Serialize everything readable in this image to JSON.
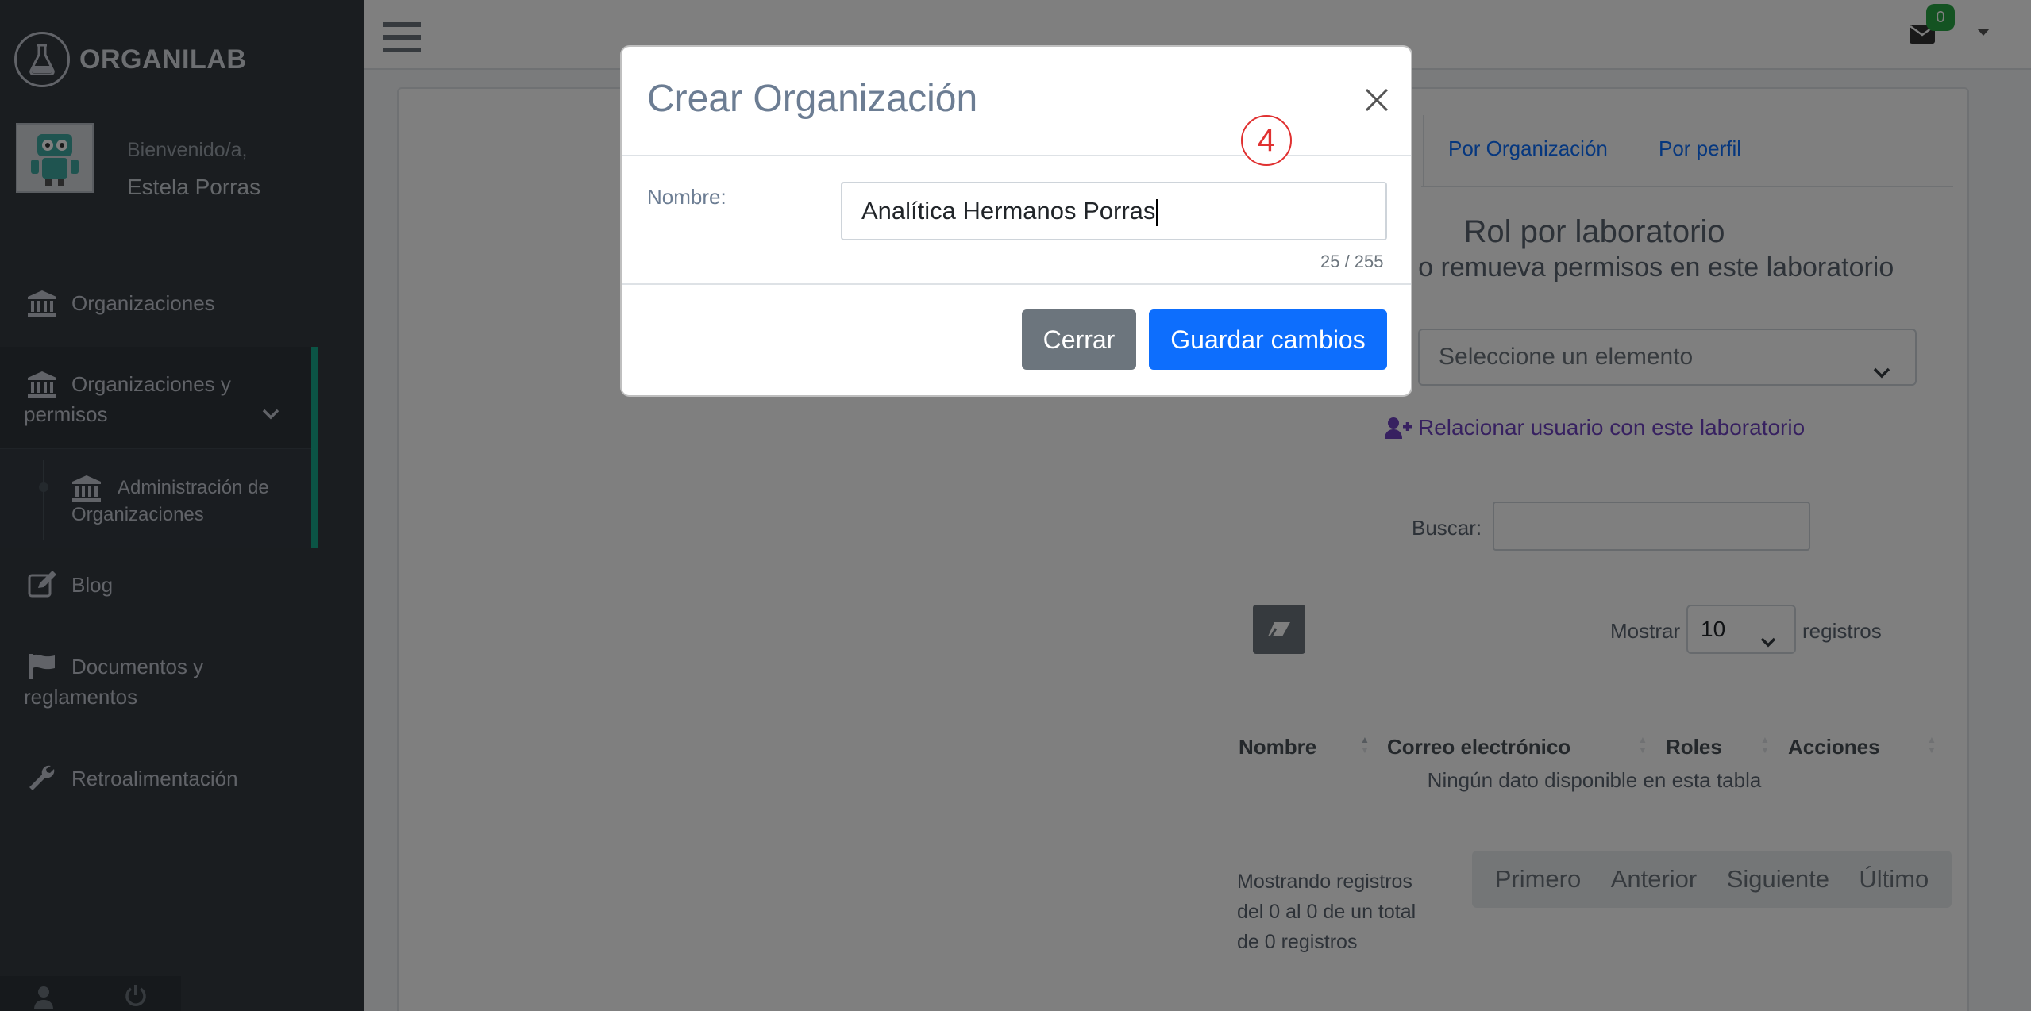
{
  "brand": {
    "name": "ORGANILAB"
  },
  "user": {
    "welcome": "Bienvenido/a,",
    "name": "Estela Porras"
  },
  "sidebar": {
    "items": [
      {
        "label": "Organizaciones",
        "icon": "bank-icon"
      },
      {
        "label": "Organizaciones y permisos",
        "icon": "bank-icon",
        "expanded": true
      },
      {
        "label": "Administración de Organizaciones",
        "icon": "bank-icon",
        "active": true
      },
      {
        "label": "Blog",
        "icon": "edit-icon"
      },
      {
        "label": "Documentos y reglamentos",
        "icon": "flag-icon"
      },
      {
        "label": "Retroalimentación",
        "icon": "wrench-icon"
      }
    ]
  },
  "header": {
    "mail_count": "0"
  },
  "tabs": [
    "Por Organización",
    "Por perfil"
  ],
  "panel": {
    "title": "Rol por laboratorio",
    "subtitle": "ada o remueva permisos en este laboratorio",
    "select_placeholder": "Seleccione un elemento",
    "relate_link": "Relacionar usuario con este laboratorio",
    "search_label": "Buscar:",
    "show_label": "Mostrar",
    "show_value": "10",
    "records_label": "registros",
    "columns": [
      "Nombre",
      "Correo electrónico",
      "Roles",
      "Acciones"
    ],
    "empty_text": "Ningún dato disponible en esta tabla",
    "info_text": "Mostrando registros del 0 al 0 de un total de 0 registros",
    "pager": [
      "Primero",
      "Anterior",
      "Siguiente",
      "Último"
    ]
  },
  "modal": {
    "title": "Crear Organización",
    "step": "4",
    "field_label": "Nombre:",
    "field_value": "Analítica Hermanos Porras",
    "counter": "25 / 255",
    "close_label": "Cerrar",
    "save_label": "Guardar cambios"
  },
  "colors": {
    "sidebar": "#343a40",
    "accent": "#17a98a",
    "primary": "#0d6efd",
    "secondary": "#6c757d",
    "badge": "#28a745",
    "step": "#e03131"
  }
}
